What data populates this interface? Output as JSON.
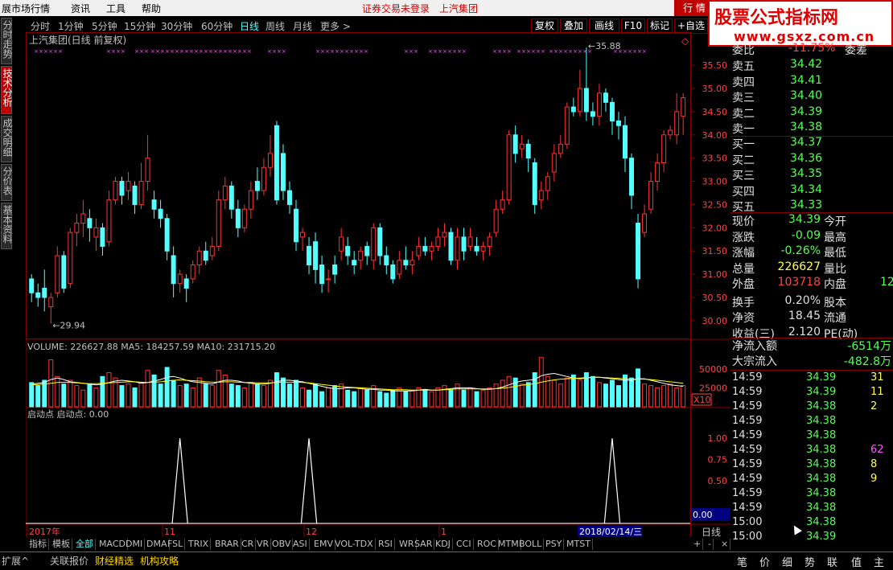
{
  "menu": {
    "items": [
      "展市场行情",
      "资讯",
      "工具",
      "帮助"
    ],
    "warning": "证券交易未登录",
    "stock_name": "上汽集团",
    "quote_button": "行 情"
  },
  "logo": {
    "line1": "股票公式指标网",
    "line2": "www.gsxz.com.cn"
  },
  "left_tabs": [
    {
      "label": "分时走势",
      "active": false
    },
    {
      "label": "技术分析",
      "active": true
    },
    {
      "label": "成交明细",
      "active": false
    },
    {
      "label": "分价表",
      "active": false
    },
    {
      "label": "基本资料",
      "active": false
    }
  ],
  "period_tabs": [
    {
      "label": "分时",
      "active": false
    },
    {
      "label": "1分钟",
      "active": false
    },
    {
      "label": "5分钟",
      "active": false
    },
    {
      "label": "15分钟",
      "active": false
    },
    {
      "label": "30分钟",
      "active": false
    },
    {
      "label": "60分钟",
      "active": false
    },
    {
      "label": "日线",
      "active": true
    },
    {
      "label": "周线",
      "active": false
    },
    {
      "label": "月线",
      "active": false
    },
    {
      "label": "更多 >",
      "active": false
    }
  ],
  "toolbar": [
    "复权",
    "叠加",
    "画线",
    "F10",
    "标记",
    "+自选"
  ],
  "main_chart": {
    "title": "上汽集团(日线 前复权)",
    "max_label": "35.88",
    "min_label": "29.94",
    "yticks": [
      "35.50",
      "35.00",
      "34.50",
      "34.00",
      "33.50",
      "33.00",
      "32.50",
      "32.00",
      "31.50",
      "31.00",
      "30.50",
      "30.00"
    ]
  },
  "volume_chart": {
    "header": "VOLUME: 226627.88  MA5: 184257.59  MA10: 231715.20",
    "yticks": [
      "50000",
      "25000"
    ],
    "unit": "X10"
  },
  "indicator_chart": {
    "header": "启动点  启动点: 0.00",
    "yticks": [
      "1.00",
      "0.75",
      "0.50"
    ],
    "value_box": "0.00"
  },
  "xaxis": {
    "labels": [
      "2017年",
      "11",
      "12",
      "1"
    ],
    "cursor_date": "2018/02/14/三",
    "period_label": "日线"
  },
  "chart_data": {
    "type": "candlestick",
    "candles": [
      [
        30.9,
        30.6,
        31.0,
        30.4
      ],
      [
        30.6,
        30.5,
        30.8,
        30.3
      ],
      [
        30.7,
        30.5,
        31.1,
        30.2
      ],
      [
        30.3,
        30.5,
        30.6,
        29.94
      ],
      [
        30.6,
        31.4,
        31.6,
        30.5
      ],
      [
        31.4,
        30.7,
        31.5,
        30.6
      ],
      [
        30.8,
        31.9,
        32.0,
        30.7
      ],
      [
        31.9,
        32.1,
        32.3,
        31.6
      ],
      [
        32.1,
        32.3,
        32.6,
        31.8
      ],
      [
        32.2,
        32.0,
        32.4,
        31.7
      ],
      [
        31.8,
        32.0,
        32.2,
        31.5
      ],
      [
        32.0,
        31.6,
        32.1,
        31.4
      ],
      [
        31.7,
        32.6,
        32.8,
        31.6
      ],
      [
        32.6,
        33.0,
        33.1,
        32.5
      ],
      [
        33.0,
        32.7,
        33.1,
        32.5
      ],
      [
        32.8,
        33.0,
        33.2,
        32.6
      ],
      [
        32.9,
        32.5,
        33.0,
        32.3
      ],
      [
        32.5,
        33.0,
        33.4,
        32.4
      ],
      [
        33.0,
        33.5,
        34.0,
        32.8
      ],
      [
        32.6,
        32.4,
        32.8,
        32.2
      ],
      [
        32.4,
        32.2,
        32.6,
        32.0
      ],
      [
        32.2,
        31.5,
        32.3,
        31.3
      ],
      [
        31.4,
        30.8,
        31.6,
        30.5
      ],
      [
        30.8,
        31.0,
        31.1,
        30.6
      ],
      [
        30.9,
        30.7,
        31.0,
        30.4
      ],
      [
        30.9,
        31.2,
        31.3,
        30.8
      ],
      [
        31.2,
        31.5,
        31.6,
        31.0
      ],
      [
        31.5,
        31.3,
        31.7,
        31.2
      ],
      [
        31.4,
        31.6,
        31.8,
        31.3
      ],
      [
        31.6,
        32.6,
        32.8,
        31.5
      ],
      [
        32.6,
        32.9,
        33.1,
        32.4
      ],
      [
        32.9,
        32.4,
        33.0,
        32.2
      ],
      [
        32.4,
        32.0,
        32.6,
        31.8
      ],
      [
        32.0,
        32.4,
        32.5,
        31.9
      ],
      [
        32.4,
        32.8,
        33.0,
        32.2
      ],
      [
        33.0,
        32.8,
        33.3,
        32.6
      ],
      [
        32.8,
        33.3,
        33.5,
        32.7
      ],
      [
        33.3,
        33.6,
        34.0,
        33.1
      ],
      [
        34.2,
        32.6,
        34.3,
        32.5
      ],
      [
        33.6,
        32.8,
        33.8,
        32.6
      ],
      [
        32.8,
        32.5,
        33.0,
        32.3
      ],
      [
        32.4,
        31.7,
        32.6,
        31.5
      ],
      [
        31.8,
        31.9,
        32.0,
        31.5
      ],
      [
        31.6,
        31.2,
        31.8,
        31.0
      ],
      [
        31.7,
        31.1,
        31.9,
        30.8
      ],
      [
        31.2,
        30.8,
        31.4,
        30.6
      ],
      [
        30.9,
        30.9,
        31.1,
        30.6
      ],
      [
        31.2,
        31.0,
        31.4,
        30.8
      ],
      [
        31.5,
        31.8,
        32.0,
        31.3
      ],
      [
        31.6,
        31.4,
        31.8,
        31.2
      ],
      [
        31.3,
        31.2,
        31.5,
        31.0
      ],
      [
        31.3,
        31.5,
        31.6,
        31.1
      ],
      [
        31.6,
        31.4,
        31.7,
        31.2
      ],
      [
        31.3,
        32.0,
        32.1,
        31.1
      ],
      [
        32.0,
        31.4,
        32.1,
        31.2
      ],
      [
        31.4,
        31.2,
        31.6,
        31.0
      ],
      [
        31.2,
        30.9,
        31.3,
        30.8
      ],
      [
        31.0,
        31.3,
        31.5,
        30.9
      ],
      [
        31.3,
        31.2,
        31.6,
        31.1
      ],
      [
        31.2,
        31.3,
        31.5,
        31.0
      ],
      [
        31.4,
        31.6,
        31.8,
        31.3
      ],
      [
        31.6,
        31.5,
        31.8,
        31.4
      ],
      [
        31.5,
        31.6,
        31.7,
        31.3
      ],
      [
        31.6,
        31.8,
        32.0,
        31.5
      ],
      [
        31.8,
        31.9,
        32.1,
        31.6
      ],
      [
        31.9,
        31.3,
        32.0,
        31.2
      ],
      [
        31.3,
        31.8,
        32.0,
        31.1
      ],
      [
        31.8,
        31.5,
        32.0,
        31.3
      ],
      [
        31.6,
        31.8,
        32.0,
        31.5
      ],
      [
        31.6,
        31.5,
        31.8,
        31.4
      ],
      [
        31.5,
        31.6,
        31.7,
        31.3
      ],
      [
        31.6,
        31.8,
        31.9,
        31.4
      ],
      [
        31.9,
        32.4,
        32.6,
        31.8
      ],
      [
        32.4,
        32.6,
        32.8,
        32.3
      ],
      [
        32.6,
        34.0,
        34.1,
        32.5
      ],
      [
        34.0,
        33.6,
        34.2,
        33.4
      ],
      [
        33.7,
        33.8,
        34.0,
        33.5
      ],
      [
        33.8,
        33.5,
        33.9,
        33.2
      ],
      [
        33.4,
        32.5,
        33.5,
        32.3
      ],
      [
        32.6,
        32.8,
        33.0,
        32.4
      ],
      [
        32.8,
        33.1,
        33.2,
        32.6
      ],
      [
        33.2,
        33.6,
        33.8,
        33.0
      ],
      [
        33.6,
        33.8,
        34.0,
        33.5
      ],
      [
        33.8,
        34.6,
        34.7,
        33.7
      ],
      [
        34.6,
        34.5,
        34.8,
        34.4
      ],
      [
        34.5,
        35.0,
        35.4,
        34.4
      ],
      [
        35.0,
        34.5,
        35.88,
        34.3
      ],
      [
        34.5,
        34.4,
        34.7,
        34.2
      ],
      [
        34.4,
        34.9,
        35.1,
        34.2
      ],
      [
        34.9,
        34.7,
        35.0,
        34.5
      ],
      [
        34.7,
        34.3,
        34.8,
        34.0
      ],
      [
        34.3,
        34.2,
        34.5,
        33.9
      ],
      [
        34.2,
        33.5,
        34.4,
        33.2
      ],
      [
        33.5,
        32.7,
        33.6,
        32.4
      ],
      [
        32.1,
        30.9,
        32.3,
        30.7
      ],
      [
        31.9,
        32.3,
        32.5,
        31.8
      ],
      [
        32.4,
        33.0,
        33.2,
        32.3
      ],
      [
        33.0,
        33.4,
        33.6,
        32.8
      ],
      [
        33.4,
        34.0,
        34.1,
        33.2
      ],
      [
        34.0,
        34.1,
        34.2,
        33.9
      ],
      [
        34.0,
        34.5,
        34.9,
        33.8
      ],
      [
        34.4,
        34.8,
        34.9,
        34.0
      ]
    ],
    "volume": [
      32000,
      28000,
      35000,
      62000,
      40000,
      30000,
      35000,
      28000,
      22000,
      30000,
      25000,
      40000,
      45000,
      38000,
      28000,
      30000,
      25000,
      32000,
      48000,
      42000,
      30000,
      52000,
      35000,
      28000,
      30000,
      25000,
      38000,
      30000,
      28000,
      48000,
      42000,
      30000,
      28000,
      25000,
      32000,
      30000,
      28000,
      35000,
      45000,
      38000,
      30000,
      35000,
      25000,
      22000,
      30000,
      20000,
      25000,
      28000,
      30000,
      22000,
      20000,
      25000,
      22000,
      28000,
      20000,
      18000,
      22000,
      25000,
      20000,
      22000,
      25000,
      22000,
      20000,
      25000,
      28000,
      22000,
      30000,
      22000,
      25000,
      20000,
      22000,
      25000,
      30000,
      35000,
      40000,
      38000,
      30000,
      32000,
      45000,
      65000,
      40000,
      35000,
      30000,
      38000,
      42000,
      35000,
      45000,
      40000,
      32000,
      30000,
      35000,
      28000,
      42000,
      38000,
      50000,
      30000,
      28000,
      25000,
      28000,
      30000,
      25000,
      28000
    ],
    "ma5": [
      30000,
      31000,
      32000,
      36000,
      38000,
      36000,
      33000,
      32000,
      31000,
      30000,
      29000,
      30000,
      32000,
      34000,
      35000,
      34000,
      33000,
      31000,
      32000,
      34000,
      36000,
      39000,
      40000,
      38000,
      35000,
      33000,
      32000,
      31000,
      30000,
      33000,
      35000,
      35000,
      34000,
      32000,
      31000,
      30000,
      30000,
      31000,
      33000,
      35000,
      35000,
      34000,
      33000,
      31000,
      29000,
      27000,
      25000,
      24000,
      24000,
      25000,
      25000,
      24000,
      23000,
      23000,
      22000,
      22000,
      21000,
      21000,
      21000,
      21000,
      22000,
      23000,
      22000,
      22000,
      23000,
      24000,
      25000,
      25000,
      25000,
      24000,
      23000,
      23000,
      24000,
      26000,
      29000,
      32000,
      34000,
      35000,
      36000,
      41000,
      43000,
      44000,
      42000,
      40000,
      38000,
      37000,
      38000,
      39000,
      39000,
      38000,
      37000,
      36000,
      35000,
      35000,
      37000,
      37000,
      35000,
      33000,
      31000,
      29000,
      28000,
      27000
    ],
    "ma10": [
      29000,
      29500,
      30000,
      31000,
      32000,
      32500,
      32000,
      31500,
      31000,
      30500,
      30500,
      31000,
      31500,
      32000,
      32500,
      33000,
      33000,
      32500,
      32000,
      32500,
      33000,
      34000,
      35000,
      35500,
      35000,
      34500,
      34000,
      33000,
      32500,
      32500,
      33000,
      33000,
      32500,
      32000,
      32000,
      31500,
      31500,
      31500,
      32000,
      32500,
      32500,
      32500,
      32000,
      31500,
      30500,
      29500,
      28500,
      27500,
      26500,
      26000,
      25500,
      25000,
      24500,
      24000,
      23500,
      23000,
      22500,
      22500,
      22500,
      22000,
      22000,
      22000,
      22000,
      22000,
      22500,
      23000,
      23500,
      23500,
      23500,
      23500,
      23500,
      23500,
      24000,
      24500,
      25500,
      27000,
      28500,
      29500,
      30500,
      32500,
      34000,
      35500,
      36500,
      37000,
      37500,
      38000,
      38500,
      39000,
      39000,
      38500,
      38000,
      37500,
      37000,
      36500,
      36500,
      36500,
      36000,
      35000,
      34000,
      33000,
      32000,
      31000
    ],
    "signal_points": [
      23,
      43,
      90
    ],
    "indicator_ylim": [
      0,
      1.2
    ],
    "price_ylim": [
      29.6,
      35.9
    ],
    "volume_ylim": [
      0,
      70000
    ]
  },
  "quote_panel": {
    "header": {
      "left": "委比",
      "mid": "-11.75%",
      "right": "委差"
    },
    "sell": [
      {
        "label": "卖五",
        "price": "34.42"
      },
      {
        "label": "卖四",
        "price": "34.41"
      },
      {
        "label": "卖三",
        "price": "34.40"
      },
      {
        "label": "卖二",
        "price": "34.39"
      },
      {
        "label": "卖一",
        "price": "34.38"
      }
    ],
    "buy": [
      {
        "label": "买一",
        "price": "34.37"
      },
      {
        "label": "买二",
        "price": "34.36"
      },
      {
        "label": "买三",
        "price": "34.35"
      },
      {
        "label": "买四",
        "price": "34.34"
      },
      {
        "label": "买五",
        "price": "34.33"
      }
    ],
    "stats": [
      {
        "l1": "现价",
        "v1": "34.39",
        "c1": "g",
        "l2": "今开"
      },
      {
        "l1": "涨跌",
        "v1": "-0.09",
        "c1": "g",
        "l2": "最高"
      },
      {
        "l1": "涨幅",
        "v1": "-0.26%",
        "c1": "g",
        "l2": "最低"
      },
      {
        "l1": "总量",
        "v1": "226627",
        "c1": "y",
        "l2": "量比"
      },
      {
        "l1": "外盘",
        "v1": "103718",
        "c1": "r",
        "l2": "内盘",
        "v2": "12",
        "c2": "g"
      },
      {
        "l1": "换手",
        "v1": "0.20%",
        "c1": "w",
        "l2": "股本"
      },
      {
        "l1": "净资",
        "v1": "18.45",
        "c1": "w",
        "l2": "流通"
      },
      {
        "l1": "收益(三)",
        "v1": "2.120",
        "c1": "w",
        "l2": "PE(动)"
      }
    ],
    "flow": [
      {
        "label": "净流入额",
        "value": "-6514万"
      },
      {
        "label": "大宗流入",
        "value": "-482.8万"
      }
    ],
    "ticks": [
      {
        "time": "14:59",
        "price": "34.39",
        "vol": "31",
        "vc": "y"
      },
      {
        "time": "14:59",
        "price": "34.39",
        "vol": "11",
        "vc": "y"
      },
      {
        "time": "14:59",
        "price": "34.38",
        "vol": "2",
        "vc": "y"
      },
      {
        "time": "14:59",
        "price": "34.38",
        "vol": "",
        "vc": "y"
      },
      {
        "time": "14:59",
        "price": "34.38",
        "vol": "",
        "vc": "y"
      },
      {
        "time": "14:59",
        "price": "34.38",
        "vol": "62",
        "vc": "m"
      },
      {
        "time": "14:59",
        "price": "34.38",
        "vol": "8",
        "vc": "y"
      },
      {
        "time": "14:59",
        "price": "34.38",
        "vol": "9",
        "vc": "y"
      },
      {
        "time": "14:59",
        "price": "34.38",
        "vol": "",
        "vc": "y"
      },
      {
        "time": "14:59",
        "price": "34.38",
        "vol": "",
        "vc": "y"
      },
      {
        "time": "15:00",
        "price": "34.38",
        "vol": "",
        "vc": "y"
      },
      {
        "time": "15:00",
        "price": "34.39",
        "vol": "",
        "vc": "y"
      }
    ],
    "bottom_tabs": [
      "笔",
      "价",
      "细",
      "势",
      "联",
      "值",
      "主"
    ]
  },
  "indicator_tabs": [
    "指标",
    "模板",
    "全部",
    "MACD",
    "DMI",
    "DMA",
    "FSL",
    "TRIX",
    "BRAR",
    "CR",
    "VR",
    "OBV",
    "ASI",
    "EMV",
    "VOL-TDX",
    "RSI",
    "WR",
    "SAR",
    "KDJ",
    "CCI",
    "ROC",
    "MTM",
    "BOLL",
    "PSY",
    "MTST"
  ],
  "status_bar": [
    "扩展^",
    "关联报价",
    "财经精选",
    "机构攻略"
  ],
  "colors": {
    "up": "#ff3232",
    "down": "#54ffff",
    "grid": "#800000",
    "ma5": "#ffffff",
    "ma10": "#ffff00",
    "signal": "#ffffff"
  }
}
